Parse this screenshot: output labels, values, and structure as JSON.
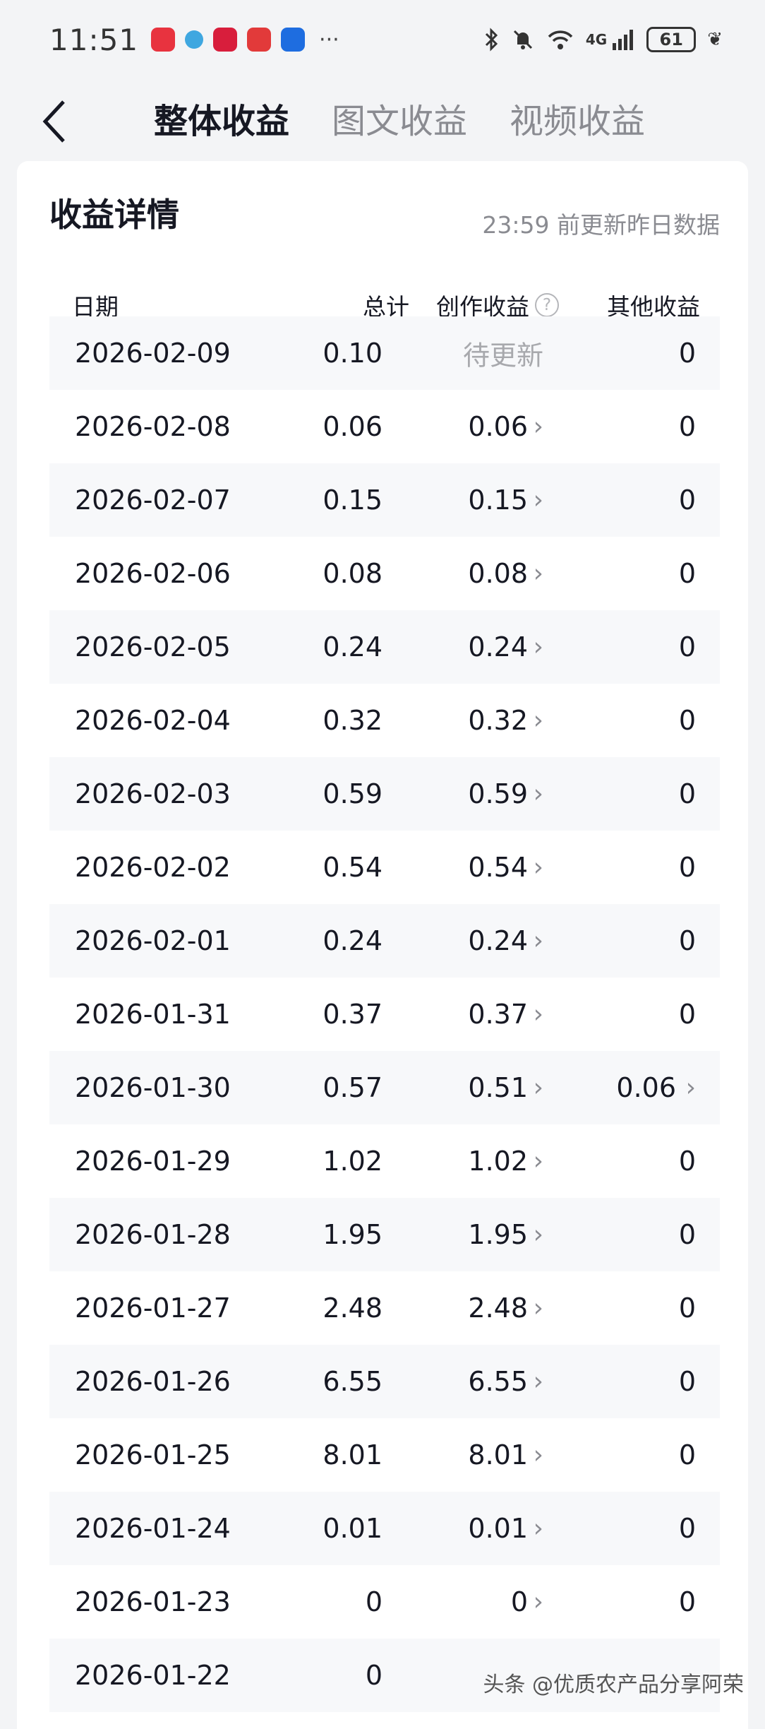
{
  "status_bar": {
    "time": "11:51",
    "battery": "61",
    "network": "4G",
    "more": "···"
  },
  "header": {
    "tabs": [
      {
        "label": "整体收益",
        "active": true
      },
      {
        "label": "图文收益",
        "active": false
      },
      {
        "label": "视频收益",
        "active": false
      }
    ]
  },
  "card": {
    "title": "收益详情",
    "note": "23:59 前更新昨日数据"
  },
  "table": {
    "columns": {
      "date": "日期",
      "total": "总计",
      "creation": "创作收益",
      "other": "其他收益"
    },
    "rows": [
      {
        "date": "2026-02-09",
        "total": "0.10",
        "creation": "待更新",
        "other": "0"
      },
      {
        "date": "2026-02-08",
        "total": "0.06",
        "creation": "0.06",
        "other": "0"
      },
      {
        "date": "2026-02-07",
        "total": "0.15",
        "creation": "0.15",
        "other": "0"
      },
      {
        "date": "2026-02-06",
        "total": "0.08",
        "creation": "0.08",
        "other": "0"
      },
      {
        "date": "2026-02-05",
        "total": "0.24",
        "creation": "0.24",
        "other": "0"
      },
      {
        "date": "2026-02-04",
        "total": "0.32",
        "creation": "0.32",
        "other": "0"
      },
      {
        "date": "2026-02-03",
        "total": "0.59",
        "creation": "0.59",
        "other": "0"
      },
      {
        "date": "2026-02-02",
        "total": "0.54",
        "creation": "0.54",
        "other": "0"
      },
      {
        "date": "2026-02-01",
        "total": "0.24",
        "creation": "0.24",
        "other": "0"
      },
      {
        "date": "2026-01-31",
        "total": "0.37",
        "creation": "0.37",
        "other": "0"
      },
      {
        "date": "2026-01-30",
        "total": "0.57",
        "creation": "0.51",
        "other": "0.06"
      },
      {
        "date": "2026-01-29",
        "total": "1.02",
        "creation": "1.02",
        "other": "0"
      },
      {
        "date": "2026-01-28",
        "total": "1.95",
        "creation": "1.95",
        "other": "0"
      },
      {
        "date": "2026-01-27",
        "total": "2.48",
        "creation": "2.48",
        "other": "0"
      },
      {
        "date": "2026-01-26",
        "total": "6.55",
        "creation": "6.55",
        "other": "0"
      },
      {
        "date": "2026-01-25",
        "total": "8.01",
        "creation": "8.01",
        "other": "0"
      },
      {
        "date": "2026-01-24",
        "total": "0.01",
        "creation": "0.01",
        "other": "0"
      },
      {
        "date": "2026-01-23",
        "total": "0",
        "creation": "0",
        "other": "0"
      },
      {
        "date": "2026-01-22",
        "total": "0",
        "creation": "",
        "other": ""
      }
    ]
  },
  "watermark": "头条 @优质农产品分享阿荣",
  "colors": {
    "accent": "#161823",
    "muted": "#8a8b91",
    "row_alt": "#f7f8fa"
  }
}
